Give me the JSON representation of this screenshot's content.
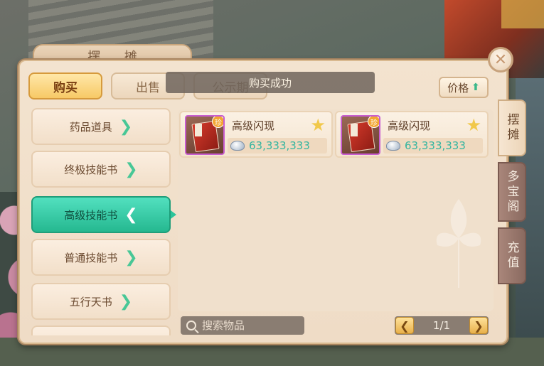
{
  "window": {
    "title": "摆 摊"
  },
  "tabs": {
    "buy": "购买",
    "sell": "出售",
    "public": "公示期"
  },
  "toast": "购买成功",
  "sort_button": {
    "label": "价格",
    "icon": "up-arrow-icon"
  },
  "categories": [
    {
      "label": "药品道具",
      "active": false
    },
    {
      "label": "终极技能书",
      "active": false
    },
    {
      "label": "高级技能书",
      "active": true
    },
    {
      "label": "普通技能书",
      "active": false
    },
    {
      "label": "五行天书",
      "active": false
    }
  ],
  "items": [
    {
      "name": "高级闪现",
      "price": "63,333,333",
      "badge": "珍",
      "icon": "skill-book-icon"
    },
    {
      "name": "高级闪现",
      "price": "63,333,333",
      "badge": "珍",
      "icon": "skill-book-icon"
    }
  ],
  "side_tabs": {
    "stall": "摆摊",
    "treasure": "多宝阁",
    "recharge": "充值"
  },
  "search": {
    "placeholder": "搜索物品"
  },
  "pager": {
    "text": "1/1"
  },
  "colors": {
    "accent": "#25b890",
    "price": "#34b5a0",
    "buy_tab": "#f7c966"
  }
}
